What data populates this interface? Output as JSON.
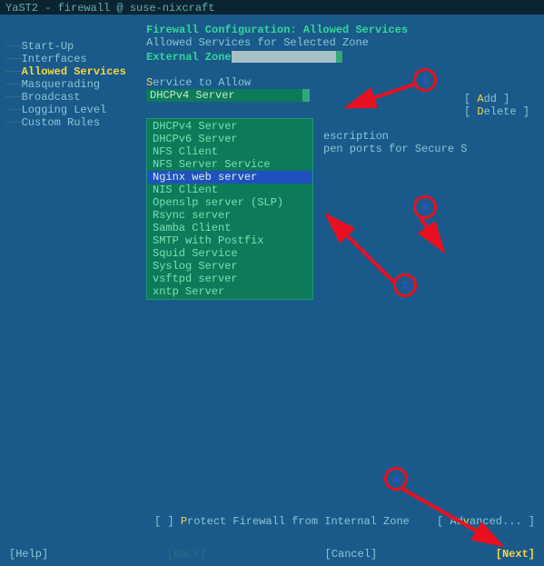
{
  "titlebar": "YaST2 - firewall @ suse-nixcraft",
  "sidebar": {
    "items": [
      {
        "label": "Start-Up",
        "active": false
      },
      {
        "label": "Interfaces",
        "active": false
      },
      {
        "label": "Allowed Services",
        "active": true
      },
      {
        "label": "Masquerading",
        "active": false
      },
      {
        "label": "Broadcast",
        "active": false
      },
      {
        "label": "Logging Level",
        "active": false
      },
      {
        "label": "Custom Rules",
        "active": false
      }
    ]
  },
  "content": {
    "heading1": "Firewall Configuration: Allowed Services",
    "heading2": "Allowed Services for Selected Zone",
    "zone_label": "External Zone",
    "service_label_pre": "S",
    "service_label_rest": "ervice to Allow",
    "service_selected": "DHCPv4 Server",
    "actions": {
      "add_pre": "[   ",
      "add_hk": "A",
      "add_post": "dd    ]",
      "del_pre": "[  ",
      "del_hk": "D",
      "del_post": "elete  ]"
    },
    "desc_title": "escription",
    "desc_body": "pen ports for Secure S",
    "dropdown": [
      "DHCPv4 Server",
      "DHCPv6 Server",
      "NFS Client",
      "NFS Server Service",
      "Nginx web server",
      "NIS Client",
      "Openslp server (SLP)",
      "Rsync server",
      "Samba Client",
      "SMTP with Postfix",
      "Squid Service",
      "Syslog Server",
      "vsftpd server",
      "xntp Server"
    ],
    "dropdown_selected_index": 4,
    "protect_pre": "[ ] ",
    "protect_hk": "P",
    "protect_post": "rotect Firewall from Internal Zone",
    "adv_pre": "[ Ad",
    "adv_hk": "v",
    "adv_post": "anced... ]"
  },
  "footer": {
    "help": "[Help]",
    "back": "[Back]",
    "cancel": "[Cancel]",
    "next": "[Next]"
  },
  "annotations": {
    "n1": "1",
    "n2": "2",
    "n3": "3",
    "n4": "4"
  }
}
